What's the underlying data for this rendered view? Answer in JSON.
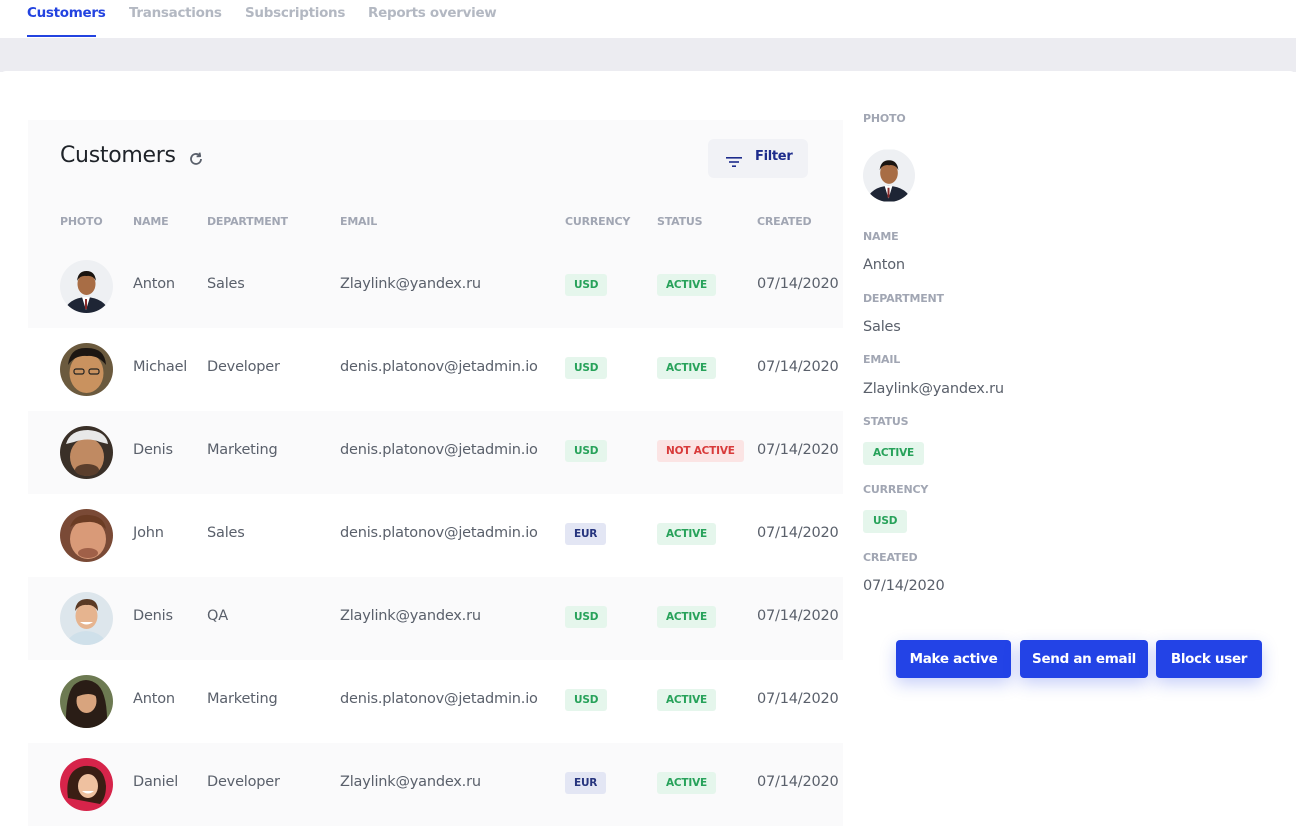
{
  "tabs": [
    {
      "label": "Customers",
      "active": true
    },
    {
      "label": "Transactions",
      "active": false
    },
    {
      "label": "Subscriptions",
      "active": false
    },
    {
      "label": "Reports overview",
      "active": false
    }
  ],
  "table": {
    "title": "Customers",
    "filter_label": "Filter",
    "columns": [
      "PHOTO",
      "NAME",
      "DEPARTMENT",
      "EMAIL",
      "CURRENCY",
      "STATUS",
      "CREATED"
    ],
    "rows": [
      {
        "name": "Anton",
        "department": "Sales",
        "email": "Zlaylink@yandex.ru",
        "currency": "USD",
        "status": "ACTIVE",
        "created": "07/14/2020"
      },
      {
        "name": "Michael",
        "department": "Developer",
        "email": "denis.platonov@jetadmin.io",
        "currency": "USD",
        "status": "ACTIVE",
        "created": "07/14/2020"
      },
      {
        "name": "Denis",
        "department": "Marketing",
        "email": "denis.platonov@jetadmin.io",
        "currency": "USD",
        "status": "NOT ACTIVE",
        "created": "07/14/2020"
      },
      {
        "name": "John",
        "department": "Sales",
        "email": "denis.platonov@jetadmin.io",
        "currency": "EUR",
        "status": "ACTIVE",
        "created": "07/14/2020"
      },
      {
        "name": "Denis",
        "department": "QA",
        "email": "Zlaylink@yandex.ru",
        "currency": "USD",
        "status": "ACTIVE",
        "created": "07/14/2020"
      },
      {
        "name": "Anton",
        "department": "Marketing",
        "email": "denis.platonov@jetadmin.io",
        "currency": "USD",
        "status": "ACTIVE",
        "created": "07/14/2020"
      },
      {
        "name": "Daniel",
        "department": "Developer",
        "email": "Zlaylink@yandex.ru",
        "currency": "EUR",
        "status": "ACTIVE",
        "created": "07/14/2020"
      }
    ]
  },
  "detail": {
    "photo_label": "PHOTO",
    "name_label": "NAME",
    "name": "Anton",
    "department_label": "DEPARTMENT",
    "department": "Sales",
    "email_label": "EMAIL",
    "email": "Zlaylink@yandex.ru",
    "status_label": "STATUS",
    "status": "ACTIVE",
    "currency_label": "CURRENCY",
    "currency": "USD",
    "created_label": "CREATED",
    "created": "07/14/2020"
  },
  "actions": {
    "make_active": "Make active",
    "send_email": "Send an email",
    "block_user": "Block user"
  },
  "colors": {
    "accent": "#2343e0",
    "active_badge": "#27a25a",
    "not_active_badge": "#d83a3a",
    "eur_badge": "#27357e"
  }
}
